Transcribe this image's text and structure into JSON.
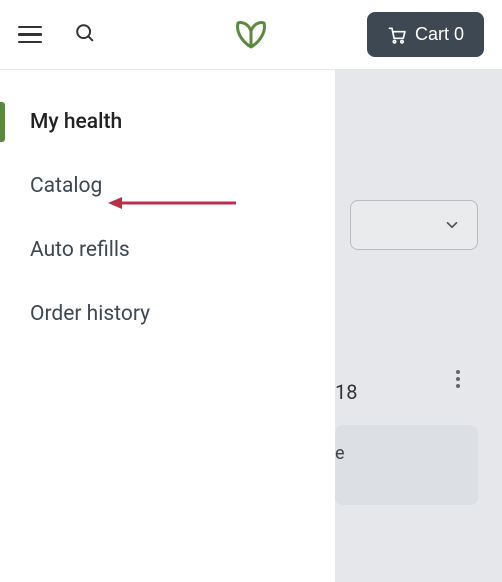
{
  "header": {
    "cart_label": "Cart 0"
  },
  "sidebar": {
    "items": [
      {
        "label": "My health"
      },
      {
        "label": "Catalog"
      },
      {
        "label": "Auto refills"
      },
      {
        "label": "Order history"
      }
    ]
  },
  "main": {
    "partial_date": "18",
    "card_partial": "e"
  },
  "colors": {
    "brand_green": "#5b8a3e",
    "cart_bg": "#3d4852",
    "arrow": "#b8304c"
  }
}
